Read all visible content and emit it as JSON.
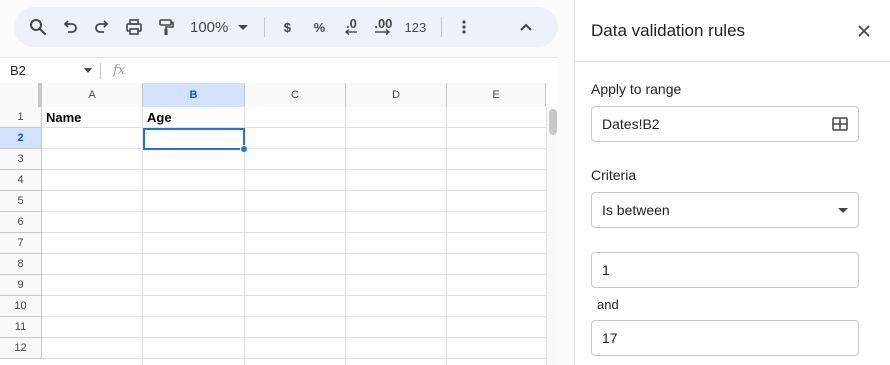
{
  "toolbar": {
    "zoom": "100%",
    "currency": "$",
    "percent": "%",
    "decrease_decimal": ".0",
    "increase_decimal": ".00",
    "number_format": "123"
  },
  "formula_bar": {
    "cell_ref": "B2",
    "fx": "fx"
  },
  "grid": {
    "columns": [
      "A",
      "B",
      "C",
      "D",
      "E"
    ],
    "rows": [
      "1",
      "2",
      "3",
      "4",
      "5",
      "6",
      "7",
      "8",
      "9",
      "10",
      "11",
      "12"
    ],
    "cells": {
      "A1": "Name",
      "B1": "Age"
    }
  },
  "panel": {
    "title": "Data validation rules",
    "apply_to_range_label": "Apply to range",
    "range_value": "Dates!B2",
    "criteria_label": "Criteria",
    "criteria_value": "Is between",
    "min_value": "1",
    "and_label": "and",
    "max_value": "17"
  },
  "colors": {
    "accent": "#1a73e8",
    "toolbar_bg": "#edf2fa",
    "header_selected": "#d3e3fd"
  }
}
